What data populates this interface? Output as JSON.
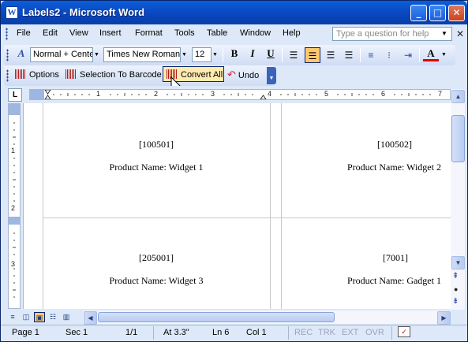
{
  "window": {
    "title": "Labels2 - Microsoft Word",
    "app_icon": "word-icon"
  },
  "menu": {
    "items": [
      "File",
      "Edit",
      "View",
      "Insert",
      "Format",
      "Tools",
      "Table",
      "Window",
      "Help"
    ],
    "help_placeholder": "Type a question for help"
  },
  "formatting": {
    "style": "Normal + Cente",
    "font": "Times New Roman",
    "size": "12",
    "bold_label": "B",
    "italic_label": "I",
    "underline_label": "U",
    "font_color_label": "A"
  },
  "barcode_toolbar": {
    "options_label": "Options",
    "selection_label": "Selection To Barcode",
    "convert_label": "Convert All",
    "undo_label": "Undo"
  },
  "ruler": {
    "h_labels": [
      "1",
      "2",
      "3",
      "4",
      "5",
      "6",
      "7"
    ],
    "v_labels": [
      "1",
      "2",
      "3"
    ]
  },
  "labels": [
    {
      "code": "[100501]",
      "name": "Product Name: Widget 1"
    },
    {
      "code": "[100502]",
      "name": "Product Name: Widget 2"
    },
    {
      "code": "[205001]",
      "name": "Product Name: Widget 3"
    },
    {
      "code": "[7001]",
      "name": "Product Name: Gadget 1"
    }
  ],
  "status": {
    "page": "Page 1",
    "sec": "Sec 1",
    "pages": "1/1",
    "at": "At 3.3\"",
    "ln": "Ln 6",
    "col": "Col 1",
    "rec": "REC",
    "trk": "TRK",
    "ext": "EXT",
    "ovr": "OVR"
  }
}
